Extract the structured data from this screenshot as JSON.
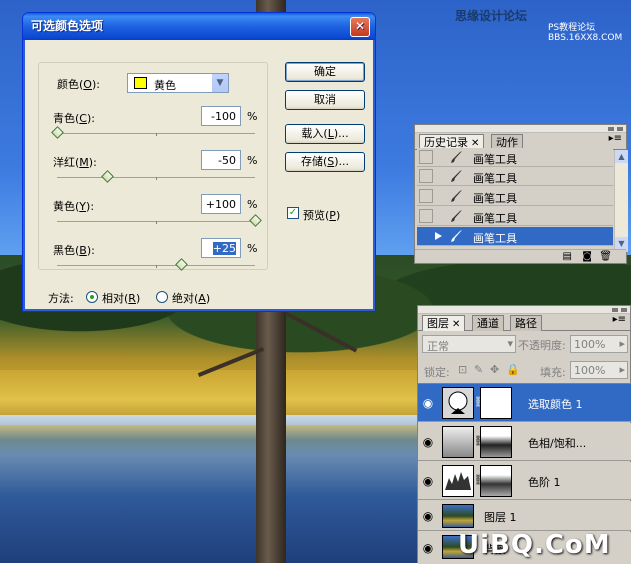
{
  "watermark": {
    "site": "思缘设计论坛",
    "sub": "PS教程论坛",
    "url": "BBS.16XX8.COM",
    "brand": "UiBQ.CoM"
  },
  "dialog": {
    "title": "可选颜色选项",
    "close": "✕",
    "colors_label": "颜色(",
    "colors_key": "O",
    "colors_label_end": "):",
    "colors_value": "黄色",
    "sliders": [
      {
        "label": "青色(",
        "key": "C",
        "end": "):",
        "value": "-100",
        "unit": "%",
        "level": -100
      },
      {
        "label": "洋红(",
        "key": "M",
        "end": "):",
        "value": "-50",
        "unit": "%",
        "level": -50
      },
      {
        "label": "黄色(",
        "key": "Y",
        "end": "):",
        "value": "+100",
        "unit": "%",
        "level": 100
      },
      {
        "label": "黑色(",
        "key": "B",
        "end": "):",
        "value": "+25",
        "unit": "%",
        "level": 25
      }
    ],
    "buttons": {
      "ok": "确定",
      "cancel": "取消",
      "load": "载入(",
      "load_key": "L",
      "load_end": ")...",
      "save": "存储(",
      "save_key": "S",
      "save_end": ")..."
    },
    "preview": {
      "label": "预览(",
      "key": "P",
      "end": ")",
      "checked": true
    },
    "method": {
      "label": "方法:",
      "relative": "相对(",
      "relative_key": "R",
      "relative_end": ")",
      "absolute": "绝对(",
      "absolute_key": "A",
      "absolute_end": ")",
      "selected": "relative"
    }
  },
  "history": {
    "tabs": [
      "历史记录",
      "动作"
    ],
    "items": [
      "画笔工具",
      "画笔工具",
      "画笔工具",
      "画笔工具",
      "画笔工具"
    ],
    "active_index": 4
  },
  "layers": {
    "tabs": [
      "图层",
      "通道",
      "路径"
    ],
    "blend_mode": "正常",
    "opacity_label": "不透明度:",
    "opacity": "100%",
    "lock_label": "锁定:",
    "fill_label": "填充:",
    "fill": "100%",
    "items": [
      {
        "name": "选取颜色 1",
        "active": true
      },
      {
        "name": "色相/饱和...",
        "active": false
      },
      {
        "name": "色阶 1",
        "active": false
      },
      {
        "name": "图层 1",
        "active": false
      },
      {
        "name": "背景",
        "active": false
      }
    ]
  }
}
